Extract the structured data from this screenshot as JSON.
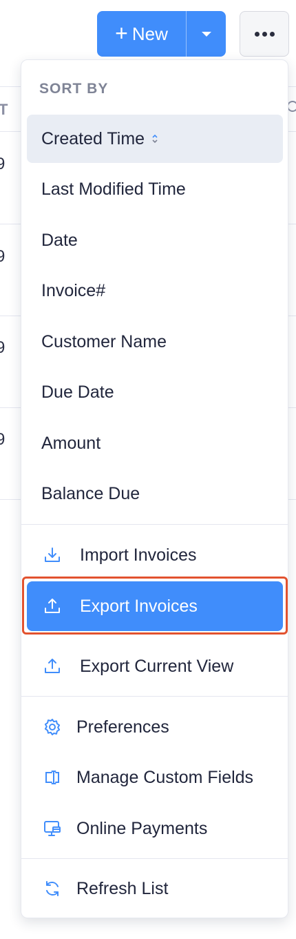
{
  "background": {
    "header_left": "T",
    "row_cells": [
      "9",
      "9",
      "9",
      "9"
    ]
  },
  "toolbar": {
    "new_label": "New",
    "plus_glyph": "+"
  },
  "menu": {
    "sort_title": "SORT BY",
    "sort_items": [
      {
        "label": "Created Time",
        "active": true
      },
      {
        "label": "Last Modified Time"
      },
      {
        "label": "Date"
      },
      {
        "label": "Invoice#"
      },
      {
        "label": "Customer Name"
      },
      {
        "label": "Due Date"
      },
      {
        "label": "Amount"
      },
      {
        "label": "Balance Due"
      }
    ],
    "actions": [
      {
        "label": "Import Invoices",
        "icon": "download-icon"
      },
      {
        "label": "Export Invoices",
        "icon": "upload-icon",
        "highlighted": true
      },
      {
        "label": "Export Current View",
        "icon": "upload-icon"
      }
    ],
    "settings": [
      {
        "label": "Preferences",
        "icon": "gear-icon"
      },
      {
        "label": "Manage Custom Fields",
        "icon": "custom-field-icon"
      },
      {
        "label": "Online Payments",
        "icon": "payment-screen-icon"
      }
    ],
    "refresh": {
      "label": "Refresh List",
      "icon": "refresh-icon"
    }
  },
  "colors": {
    "accent": "#408dfb",
    "highlight_border": "#e2522f",
    "active_bg": "#e9edf4",
    "text": "#21263c",
    "muted": "#7f8496"
  }
}
